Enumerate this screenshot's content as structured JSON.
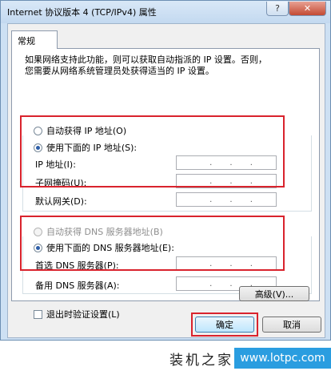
{
  "window": {
    "title": "Internet 协议版本 4 (TCP/IPv4) 属性",
    "help_label": "?",
    "close_label": "✕"
  },
  "tab": {
    "label": "常规"
  },
  "description": {
    "line1": "如果网络支持此功能，则可以获取自动指派的 IP 设置。否则，",
    "line2": "您需要从网络系统管理员处获得适当的 IP 设置。"
  },
  "ip_section": {
    "auto_label": "自动获得 IP 地址(O)",
    "manual_label": "使用下面的 IP 地址(S):",
    "selected": "manual",
    "fields": [
      {
        "label": "IP 地址(I):",
        "value": ""
      },
      {
        "label": "子网掩码(U):",
        "value": ""
      },
      {
        "label": "默认网关(D):",
        "value": ""
      }
    ]
  },
  "dns_section": {
    "auto_label": "自动获得 DNS 服务器地址(B)",
    "manual_label": "使用下面的 DNS 服务器地址(E):",
    "selected": "manual",
    "fields": [
      {
        "label": "首选 DNS 服务器(P):",
        "value": ""
      },
      {
        "label": "备用 DNS 服务器(A):",
        "value": ""
      }
    ]
  },
  "validate_label": "退出时验证设置(L)",
  "advanced_label": "高级(V)...",
  "ok_label": "确定",
  "cancel_label": "取消",
  "ip_separator": ".",
  "watermark": {
    "text": "装机之家",
    "url": "www.lotpc.com"
  },
  "colors": {
    "highlight": "#d9232d",
    "accent": "#2d5ea8"
  }
}
